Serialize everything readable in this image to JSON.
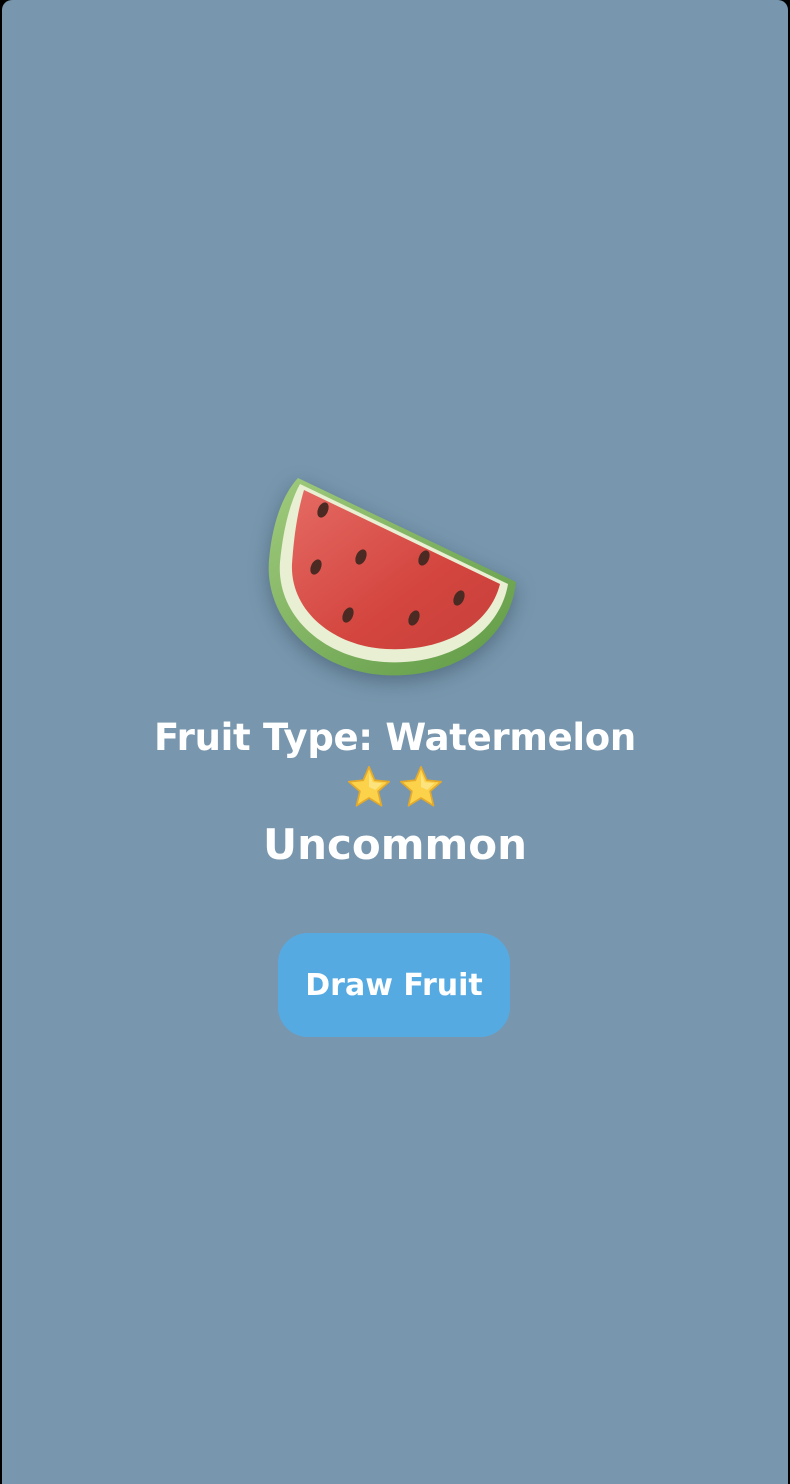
{
  "app": {
    "background_color": "#7897ae",
    "accent_color": "#56aae2"
  },
  "fruit": {
    "icon": "watermelon-icon",
    "type_label": "Fruit Type: Watermelon",
    "rating": {
      "stars": 2,
      "icon": "star-icon"
    },
    "rarity": "Uncommon"
  },
  "actions": {
    "draw_label": "Draw Fruit"
  }
}
